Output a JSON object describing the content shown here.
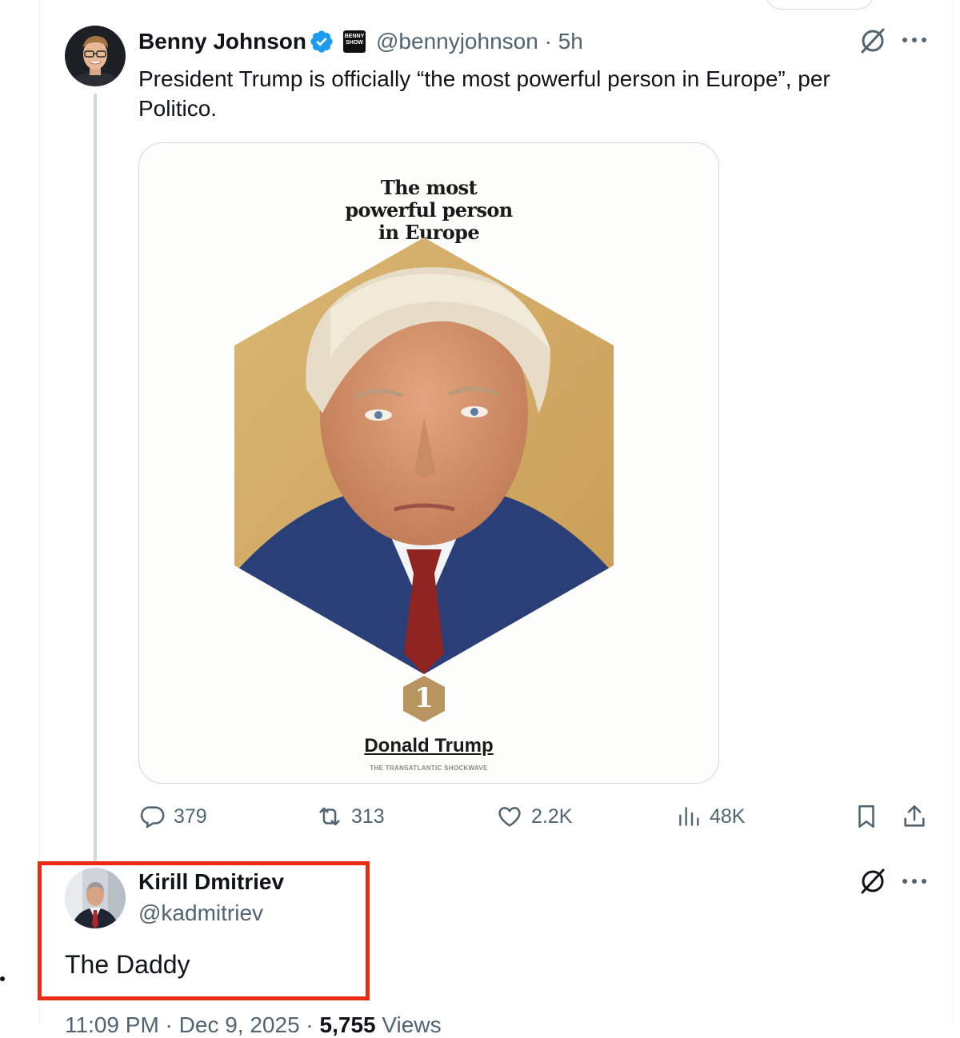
{
  "post": {
    "author_name": "Benny Johnson",
    "badge_text": "BENNY SHOW",
    "handle_time": "@bennyjohnson · 5h",
    "text": "President Trump is officially “the most powerful person in Europe”, per Politico.",
    "media": {
      "headline": "The most powerful person in Europe",
      "rank": "1",
      "subject_name": "Donald Trump",
      "subtitle": "THE TRANSATLANTIC SHOCKWAVE"
    },
    "actions": {
      "replies": "379",
      "reposts": "313",
      "likes": "2.2K",
      "views": "48K"
    }
  },
  "reply": {
    "author_name": "Kirill Dmitriev",
    "handle": "@kadmitriev",
    "text": "The Daddy"
  },
  "footer": {
    "time_date": "11:09 PM · Dec 9, 2025 ·",
    "views_count": "5,755",
    "views_label": "Views"
  },
  "colors": {
    "accent_verified": "#1d9bf0",
    "secondary_text": "#536471",
    "highlight_box": "#ec2b14"
  },
  "icons": [
    "verified-icon",
    "grok-icon",
    "more-icon",
    "reply-icon",
    "repost-icon",
    "like-icon",
    "views-icon",
    "bookmark-icon",
    "share-icon"
  ]
}
